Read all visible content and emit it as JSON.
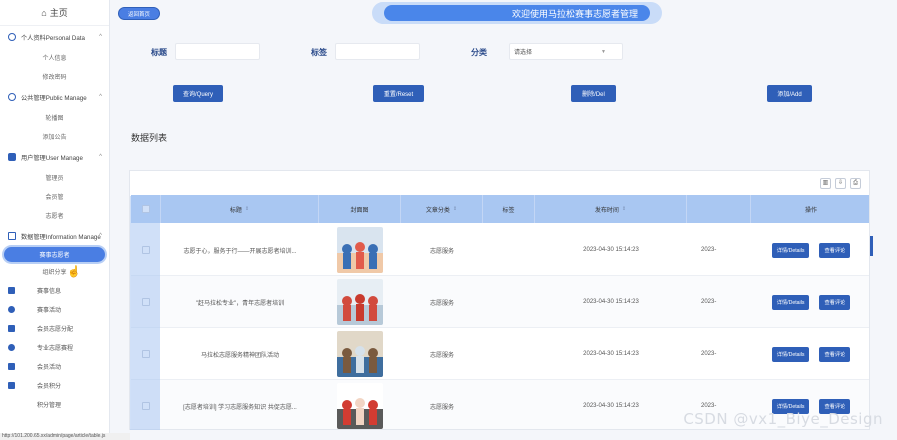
{
  "sidebar": {
    "home": "主页",
    "groups": [
      {
        "label": "个人资料Personal Data",
        "items": [
          "个人信息",
          "修改密码"
        ]
      },
      {
        "label": "公共管理Public Manage",
        "items": [
          "轮播图",
          "添加公告"
        ]
      },
      {
        "label": "用户管理User Manage",
        "items": [
          "管理员",
          "会员管",
          "志愿者"
        ]
      },
      {
        "label": "数据管理Information Manage",
        "items": [
          "赛事志愿者",
          "组织分享"
        ]
      }
    ],
    "extra": [
      "赛事信息",
      "赛事活动",
      "会员志愿分配",
      "专业志愿赛程",
      "会员活动",
      "会员积分",
      "积分管理"
    ]
  },
  "header": {
    "back_label": "返回首页",
    "title": "欢迎使用马拉松赛事志愿者管理"
  },
  "search": {
    "title_label": "标题",
    "tag_label": "标签",
    "category_label": "分类",
    "title_value": "",
    "tag_value": "",
    "category_placeholder": "请选择"
  },
  "actions": {
    "query": "查询/Query",
    "reset": "重置/Reset",
    "delete": "删除/Del",
    "add": "添加/Add"
  },
  "list_title": "数据列表",
  "table": {
    "columns": [
      "标题",
      "封面图",
      "文章分类",
      "标签",
      "发布时间",
      "",
      "操作"
    ],
    "rows": [
      {
        "title": "志愿于心，服务于行——开展志愿者培训...",
        "category": "志愿服务",
        "tag": "",
        "time": "2023-04-30 15:14:23",
        "time2": "2023-",
        "cover": "cover-1"
      },
      {
        "title": "\"赶马拉松专业\"，青年志愿者培训",
        "category": "志愿服务",
        "tag": "",
        "time": "2023-04-30 15:14:23",
        "time2": "2023-",
        "cover": "cover-2"
      },
      {
        "title": "马拉松志愿服务精神团队活动",
        "category": "志愿服务",
        "tag": "",
        "time": "2023-04-30 15:14:23",
        "time2": "2023-",
        "cover": "cover-3"
      },
      {
        "title": "[志愿者培训] 学习志愿服务知识 共促志愿...",
        "category": "志愿服务",
        "tag": "",
        "time": "2023-04-30 15:14:23",
        "time2": "2023-",
        "cover": "cover-4"
      }
    ],
    "detail_label": "详情/Details",
    "comment_label": "查看评论"
  },
  "status_url": "http://101.200.65.xx/admin/page/article/table.js",
  "watermark": "CSDN @vx1_Biye_Design",
  "colors": {
    "accent": "#2f5fb8",
    "header_row": "#a9c7f2",
    "title_bar": "#4a86ea"
  }
}
